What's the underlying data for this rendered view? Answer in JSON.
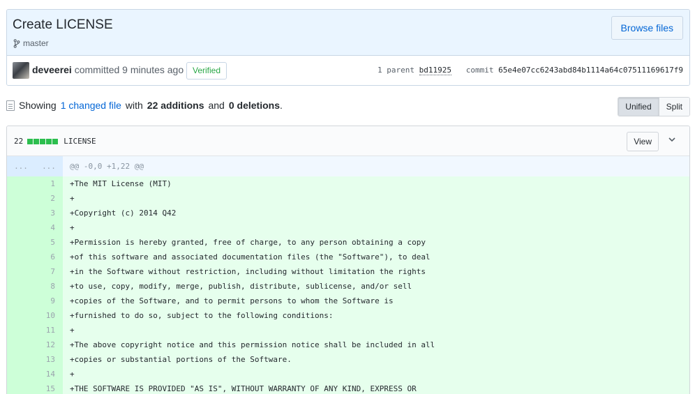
{
  "commit": {
    "title": "Create LICENSE",
    "branch": "master",
    "browse_label": "Browse files",
    "author": "deveerei",
    "committed_text": "committed 9 minutes ago",
    "verified_label": "Verified",
    "parent_label": "1 parent",
    "parent_sha": "bd11925",
    "commit_label": "commit",
    "commit_sha": "65e4e07cc6243abd84b1114a64c07511169617f9"
  },
  "toc": {
    "showing": "Showing",
    "changed_files": "1 changed file",
    "with": "with",
    "additions": "22 additions",
    "and": "and",
    "deletions": "0 deletions",
    "period": ".",
    "unified_label": "Unified",
    "split_label": "Split"
  },
  "file": {
    "changes_count": "22",
    "filename": "LICENSE",
    "view_label": "View",
    "hunk_left": "...",
    "hunk_right": "...",
    "hunk_header": "@@ -0,0 +1,22 @@",
    "lines": [
      {
        "num": "1",
        "text": "+The MIT License (MIT)"
      },
      {
        "num": "2",
        "text": "+"
      },
      {
        "num": "3",
        "text": "+Copyright (c) 2014 Q42"
      },
      {
        "num": "4",
        "text": "+"
      },
      {
        "num": "5",
        "text": "+Permission is hereby granted, free of charge, to any person obtaining a copy"
      },
      {
        "num": "6",
        "text": "+of this software and associated documentation files (the \"Software\"), to deal"
      },
      {
        "num": "7",
        "text": "+in the Software without restriction, including without limitation the rights"
      },
      {
        "num": "8",
        "text": "+to use, copy, modify, merge, publish, distribute, sublicense, and/or sell"
      },
      {
        "num": "9",
        "text": "+copies of the Software, and to permit persons to whom the Software is"
      },
      {
        "num": "10",
        "text": "+furnished to do so, subject to the following conditions:"
      },
      {
        "num": "11",
        "text": "+"
      },
      {
        "num": "12",
        "text": "+The above copyright notice and this permission notice shall be included in all"
      },
      {
        "num": "13",
        "text": "+copies or substantial portions of the Software."
      },
      {
        "num": "14",
        "text": "+"
      },
      {
        "num": "15",
        "text": "+THE SOFTWARE IS PROVIDED \"AS IS\", WITHOUT WARRANTY OF ANY KIND, EXPRESS OR"
      }
    ]
  },
  "colors": {
    "link": "#0366d6",
    "verified": "#28a745",
    "addition_bg": "#e6ffed",
    "addition_num_bg": "#cdffd8",
    "diffstat_green": "#2cbe4e"
  }
}
